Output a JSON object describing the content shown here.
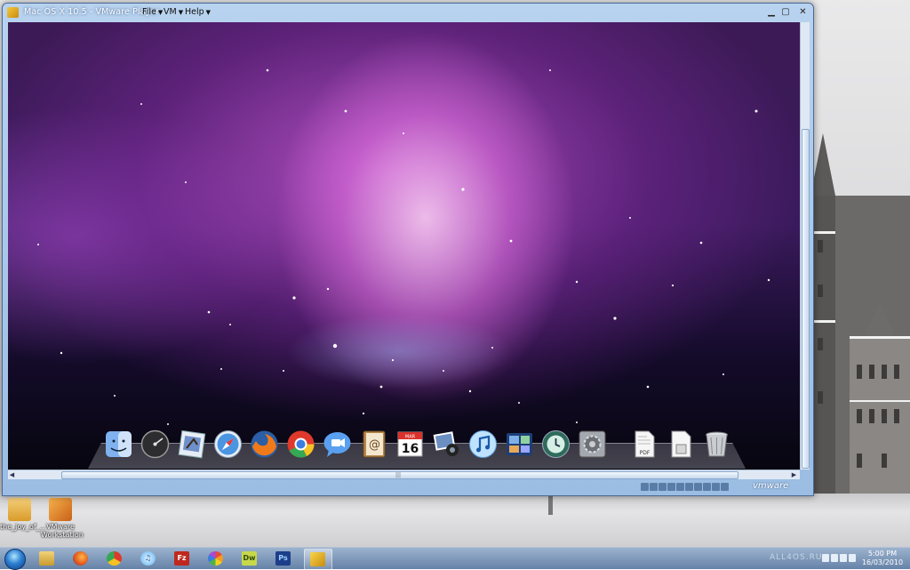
{
  "vm_window": {
    "title": "Mac OS X 10.5 - VMware Player",
    "menus": [
      {
        "label": "File"
      },
      {
        "label": "VM"
      },
      {
        "label": "Help"
      }
    ],
    "status_brand": "vmware"
  },
  "guest": {
    "dock_apps": [
      {
        "name": "Finder",
        "icon": "finder-icon",
        "color": "#4b8fe0"
      },
      {
        "name": "Dashboard",
        "icon": "dashboard-icon",
        "color": "#3a3a3a"
      },
      {
        "name": "Mail",
        "icon": "mail-icon",
        "color": "#6b88c4"
      },
      {
        "name": "Safari",
        "icon": "safari-icon",
        "color": "#3b8ede"
      },
      {
        "name": "Firefox",
        "icon": "firefox-icon",
        "color": "#e66a1c"
      },
      {
        "name": "Chrome",
        "icon": "chrome-icon",
        "color": "#3aa655"
      },
      {
        "name": "iChat",
        "icon": "ichat-icon",
        "color": "#3c84e6"
      },
      {
        "name": "Address Book",
        "icon": "address-book-icon",
        "color": "#b8874a"
      },
      {
        "name": "iCal",
        "icon": "ical-icon",
        "color": "#ffffff",
        "text": "16",
        "small_text": "MAR"
      },
      {
        "name": "iPhoto",
        "icon": "iphoto-icon",
        "color": "#8aa3c8"
      },
      {
        "name": "iTunes",
        "icon": "itunes-icon",
        "color": "#5ab0f0"
      },
      {
        "name": "Spaces",
        "icon": "spaces-icon",
        "color": "#2b5fa8"
      },
      {
        "name": "Time Machine",
        "icon": "time-machine-icon",
        "color": "#2f6b5b"
      },
      {
        "name": "System Preferences",
        "icon": "system-preferences-icon",
        "color": "#8f9399"
      },
      {
        "name": "PDF Document",
        "icon": "pdf-document-icon",
        "color": "#f4f4f4",
        "text": "PDF"
      },
      {
        "name": "Document",
        "icon": "document-icon",
        "color": "#f4f4f4"
      },
      {
        "name": "Trash",
        "icon": "trash-icon",
        "color": "#c9ccd1"
      }
    ]
  },
  "desktop_icons": [
    {
      "label": "the_joy_of_...",
      "icon": "folder-icon",
      "color": "#e7b44a"
    },
    {
      "label": "VMware Workstation",
      "icon": "vmware-workstation-icon",
      "color": "#e68a2e"
    }
  ],
  "taskbar": {
    "apps": [
      {
        "name": "Windows Explorer",
        "icon": "explorer-icon",
        "color": "#e8c060",
        "active": false
      },
      {
        "name": "Firefox",
        "icon": "firefox-icon",
        "color": "#e66a1c",
        "active": false
      },
      {
        "name": "Chrome",
        "icon": "chrome-icon",
        "color": "#3aa655",
        "active": false
      },
      {
        "name": "iTunes",
        "icon": "itunes-icon",
        "color": "#5ab0f0",
        "active": false
      },
      {
        "name": "FileZilla",
        "icon": "filezilla-icon",
        "color": "#c0281e",
        "text": "Fz",
        "active": false
      },
      {
        "name": "Picasa",
        "icon": "picasa-icon",
        "color": "#d84a9a",
        "active": false
      },
      {
        "name": "Dreamweaver",
        "icon": "dreamweaver-icon",
        "color": "#6a8f1f",
        "text": "Dw",
        "active": false
      },
      {
        "name": "Photoshop",
        "icon": "photoshop-icon",
        "color": "#1d3f8a",
        "text": "Ps",
        "active": false
      },
      {
        "name": "VMware Player",
        "icon": "vmware-player-icon",
        "color": "#e5b31f",
        "active": true
      }
    ],
    "watermark": "ALL4OS.RU",
    "clock": {
      "time": "5:00 PM",
      "date": "16/03/2010"
    }
  }
}
